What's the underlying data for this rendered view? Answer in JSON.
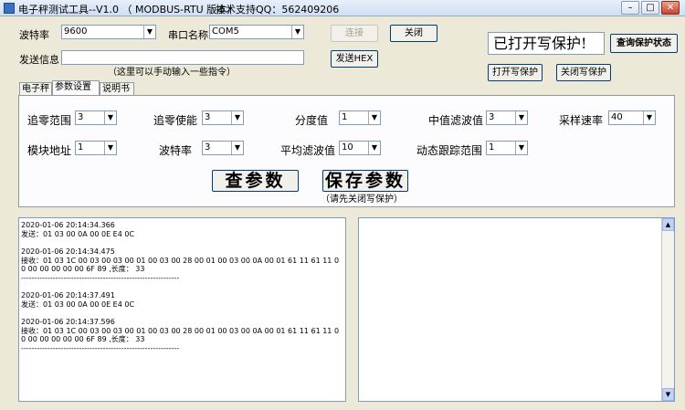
{
  "window": {
    "title": "电子秤测试工具--V1.0 （ MODBUS-RTU 版本）",
    "support": "技术支持QQ：562409206",
    "minimize": "–",
    "maximize": "□",
    "close": "✕"
  },
  "top": {
    "baud_label": "波特率",
    "baud_value": "9600",
    "port_label": "串口名称",
    "port_value": "COM5",
    "connect_label": "连接",
    "close_label": "关闭",
    "send_label": "发送信息",
    "send_value": "",
    "send_hint": "（这里可以手动输入一些指令）",
    "send_hex_label": "发送HEX",
    "protect_status": "已打开写保护!",
    "query_protect_label": "查询保护状态",
    "open_protect_label": "打开写保护",
    "close_protect_label": "关闭写保护"
  },
  "tabs": [
    "电子秤",
    "参数设置",
    "说明书"
  ],
  "params": {
    "zero_range": {
      "label": "追零范围",
      "value": "3"
    },
    "zero_enable": {
      "label": "追零使能",
      "value": "3"
    },
    "division": {
      "label": "分度值",
      "value": "1"
    },
    "median_filter": {
      "label": "中值滤波值",
      "value": "3"
    },
    "sample_rate": {
      "label": "采样速率",
      "value": "40"
    },
    "module_addr": {
      "label": "模块地址",
      "value": "1"
    },
    "baud": {
      "label": "波特率",
      "value": "3"
    },
    "avg_filter": {
      "label": "平均滤波值",
      "value": "10"
    },
    "dyn_track": {
      "label": "动态跟踪范围",
      "value": "1"
    },
    "query_label": "查参数",
    "save_label": "保存参数",
    "save_hint": "（请先关闭写保护）"
  },
  "log": [
    {
      "time": "2020-01-06 20:14:34.366",
      "text": "发送：01 03 00 0A 00 0E E4 0C"
    },
    {
      "time": "2020-01-06 20:14:34.475",
      "text": "接收：01 03 1C 00 03 00 03 00 01 00 03 00 28 00 01 00 03 00 0A 00 01 61 11 61 11 00 00 00 00 00 00 6F 89 ,长度： 33",
      "sep": "------------------------------------------------------------"
    },
    {
      "time": "2020-01-06 20:14:37.491",
      "text": "发送：01 03 00 0A 00 0E E4 0C"
    },
    {
      "time": "2020-01-06 20:14:37.596",
      "text": "接收：01 03 1C 00 03 00 03 00 01 00 03 00 28 00 01 00 03 00 0A 00 01 61 11 61 11 00 00 00 00 00 00 6F 89 ,长度： 33",
      "sep": "------------------------------------------------------------"
    }
  ]
}
